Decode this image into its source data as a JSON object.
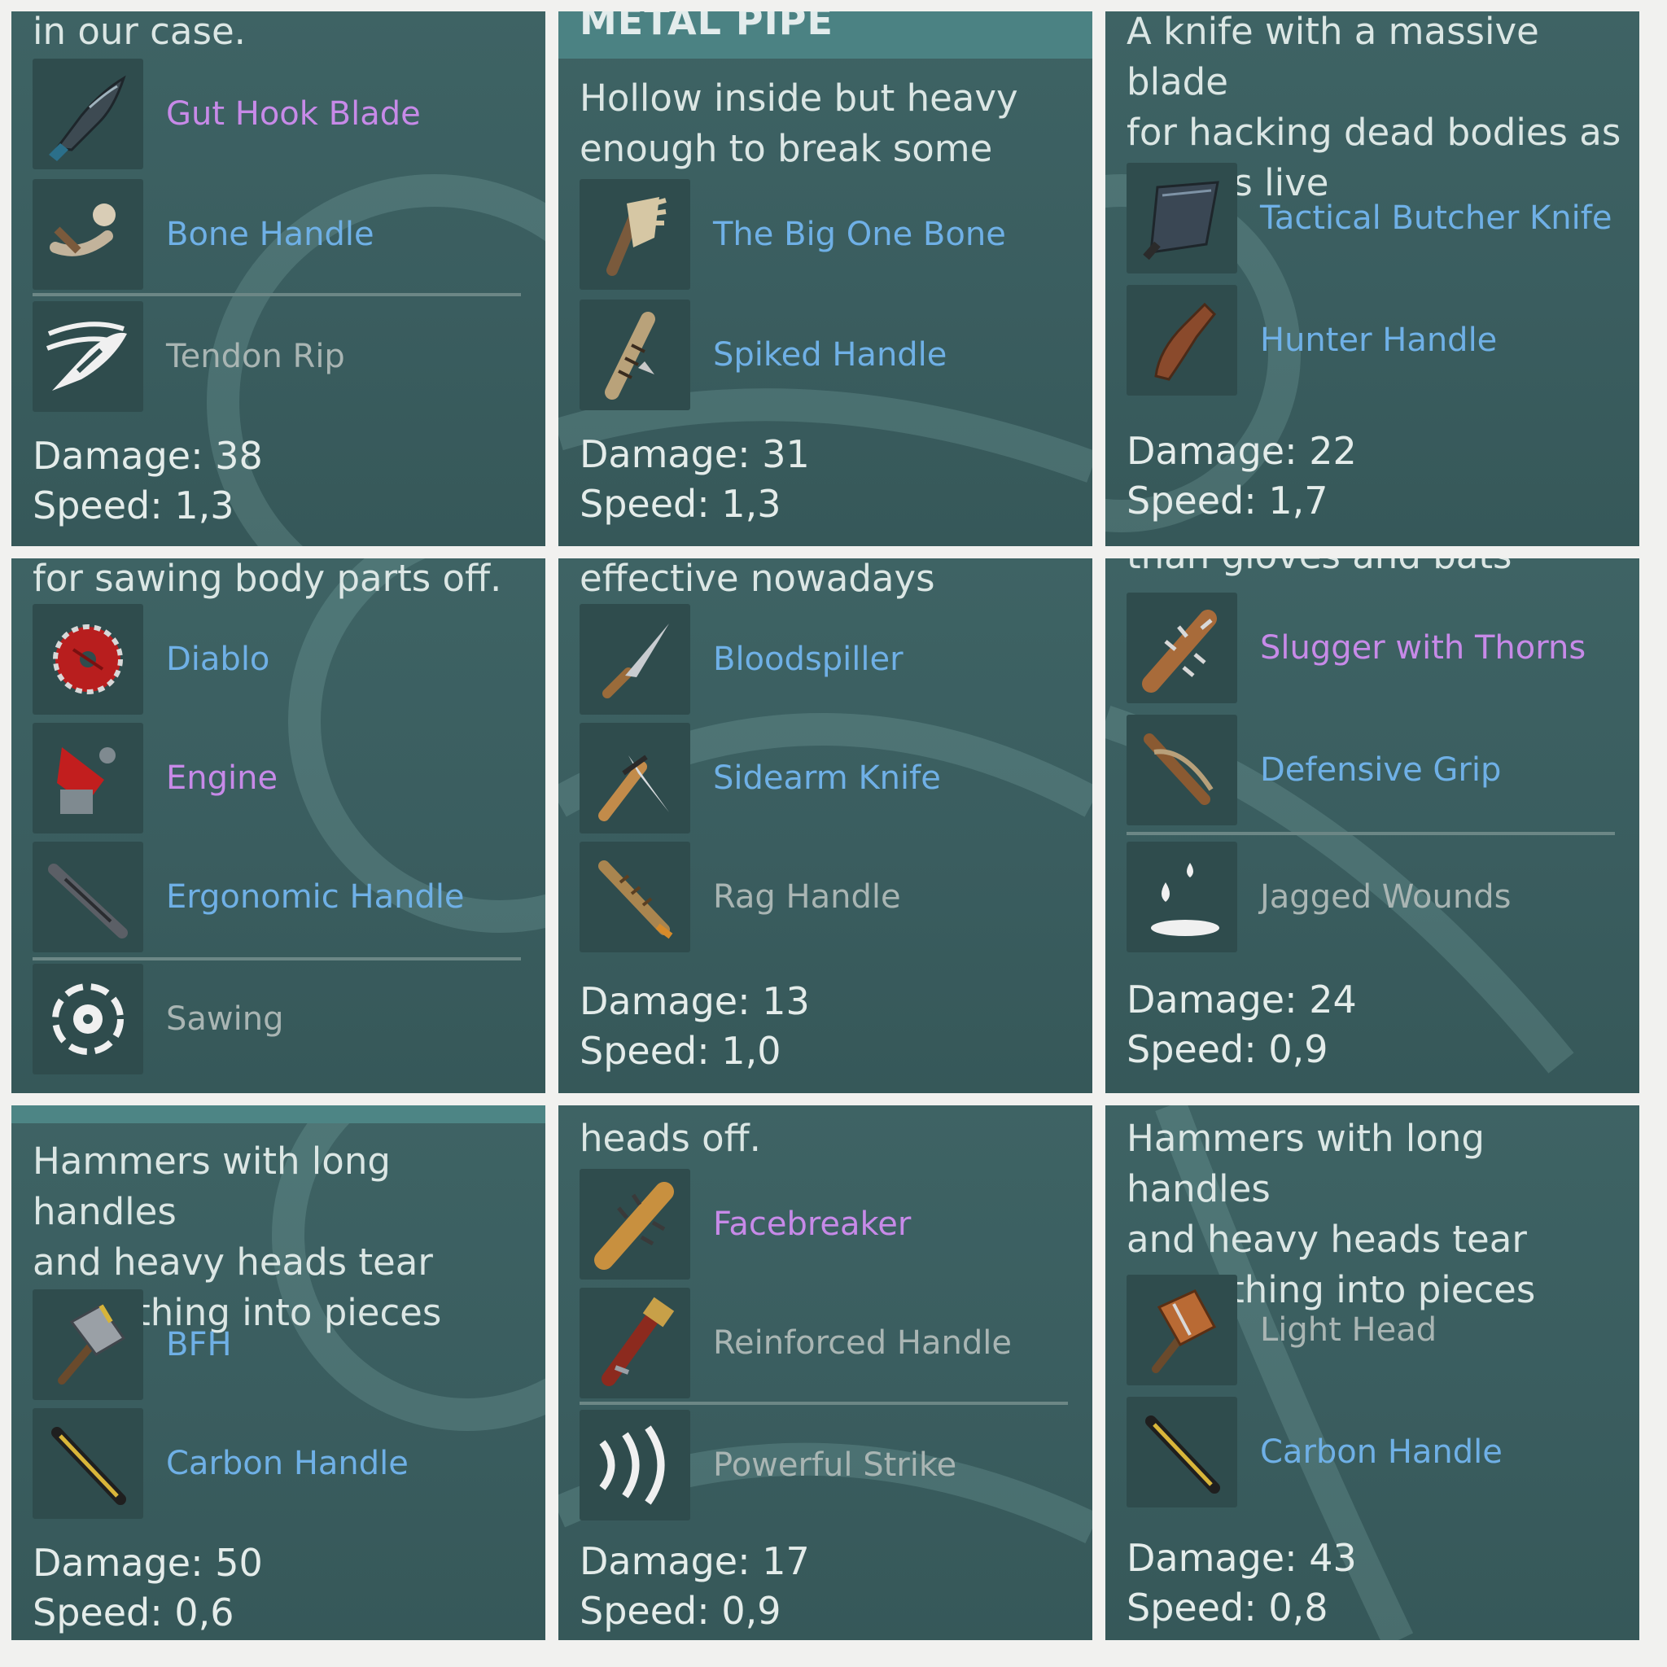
{
  "panels": [
    {
      "description": "in our case.",
      "items": [
        {
          "label": "Gut Hook Blade",
          "rarity": "epic",
          "icon": "gut-hook-blade-icon"
        },
        {
          "label": "Bone Handle",
          "rarity": "rare",
          "icon": "bone-handle-icon"
        },
        {
          "label": "Tendon Rip",
          "rarity": "skill",
          "icon": "tendon-rip-icon"
        }
      ],
      "damage": "Damage: 38",
      "speed": "Speed: 1,3"
    },
    {
      "header": "METAL PIPE",
      "description": "Hollow inside but heavy\nenough to break some skull",
      "items": [
        {
          "label": "The Big One Bone",
          "rarity": "rare",
          "icon": "big-one-bone-icon"
        },
        {
          "label": "Spiked Handle",
          "rarity": "rare",
          "icon": "spiked-handle-icon"
        }
      ],
      "damage": "Damage: 31",
      "speed": "Speed: 1,3"
    },
    {
      "description": "A knife with a massive blade\nfor hacking dead bodies as\nwell as live",
      "items": [
        {
          "label": "Tactical Butcher Knife",
          "rarity": "rare",
          "icon": "butcher-knife-icon"
        },
        {
          "label": "Hunter Handle",
          "rarity": "rare",
          "icon": "hunter-handle-icon"
        }
      ],
      "damage": "Damage: 22",
      "speed": "Speed: 1,7"
    },
    {
      "description": "for sawing body parts off.",
      "items": [
        {
          "label": "Diablo",
          "rarity": "rare",
          "icon": "saw-blade-icon"
        },
        {
          "label": "Engine",
          "rarity": "epic",
          "icon": "engine-icon"
        },
        {
          "label": "Ergonomic Handle",
          "rarity": "rare",
          "icon": "ergonomic-handle-icon"
        },
        {
          "label": "Sawing",
          "rarity": "skill",
          "icon": "sawing-icon"
        }
      ]
    },
    {
      "description": "effective nowadays",
      "items": [
        {
          "label": "Bloodspiller",
          "rarity": "rare",
          "icon": "bloodspiller-icon"
        },
        {
          "label": "Sidearm Knife",
          "rarity": "rare",
          "icon": "sidearm-knife-icon"
        },
        {
          "label": "Rag Handle",
          "rarity": "common",
          "icon": "rag-handle-icon"
        }
      ],
      "damage": "Damage: 13",
      "speed": "Speed: 1,0"
    },
    {
      "description": "than gloves and bats",
      "items": [
        {
          "label": "Slugger with Thorns",
          "rarity": "epic",
          "icon": "slugger-thorns-icon"
        },
        {
          "label": "Defensive Grip",
          "rarity": "rare",
          "icon": "defensive-grip-icon"
        },
        {
          "label": "Jagged Wounds",
          "rarity": "skill",
          "icon": "jagged-wounds-icon"
        }
      ],
      "damage": "Damage: 24",
      "speed": "Speed: 0,9"
    },
    {
      "description": "Hammers with long handles\nand heavy heads tear\neverything into pieces",
      "items": [
        {
          "label": "BFH",
          "rarity": "rare",
          "icon": "sledgehammer-icon"
        },
        {
          "label": "Carbon Handle",
          "rarity": "rare",
          "icon": "carbon-handle-icon"
        }
      ],
      "damage": "Damage: 50",
      "speed": "Speed: 0,6"
    },
    {
      "description": "heads off.",
      "items": [
        {
          "label": "Facebreaker",
          "rarity": "epic",
          "icon": "facebreaker-icon"
        },
        {
          "label": "Reinforced Handle",
          "rarity": "common",
          "icon": "reinforced-handle-icon"
        },
        {
          "label": "Powerful Strike",
          "rarity": "skill",
          "icon": "powerful-strike-icon"
        }
      ],
      "damage": "Damage: 17",
      "speed": "Speed: 0,9"
    },
    {
      "description": "Hammers with long handles\nand heavy heads tear\neverything into pieces",
      "items": [
        {
          "label": "Light Head",
          "rarity": "common",
          "icon": "light-head-icon"
        },
        {
          "label": "Carbon Handle",
          "rarity": "rare",
          "icon": "carbon-handle-icon"
        }
      ],
      "damage": "Damage: 43",
      "speed": "Speed: 0,8"
    }
  ],
  "colors": {
    "epic": "#c78ae8",
    "rare": "#6fb0e6",
    "common": "#a9b5b3",
    "panel": "#3a5d5f",
    "icon_tile": "#2f4c4d"
  }
}
